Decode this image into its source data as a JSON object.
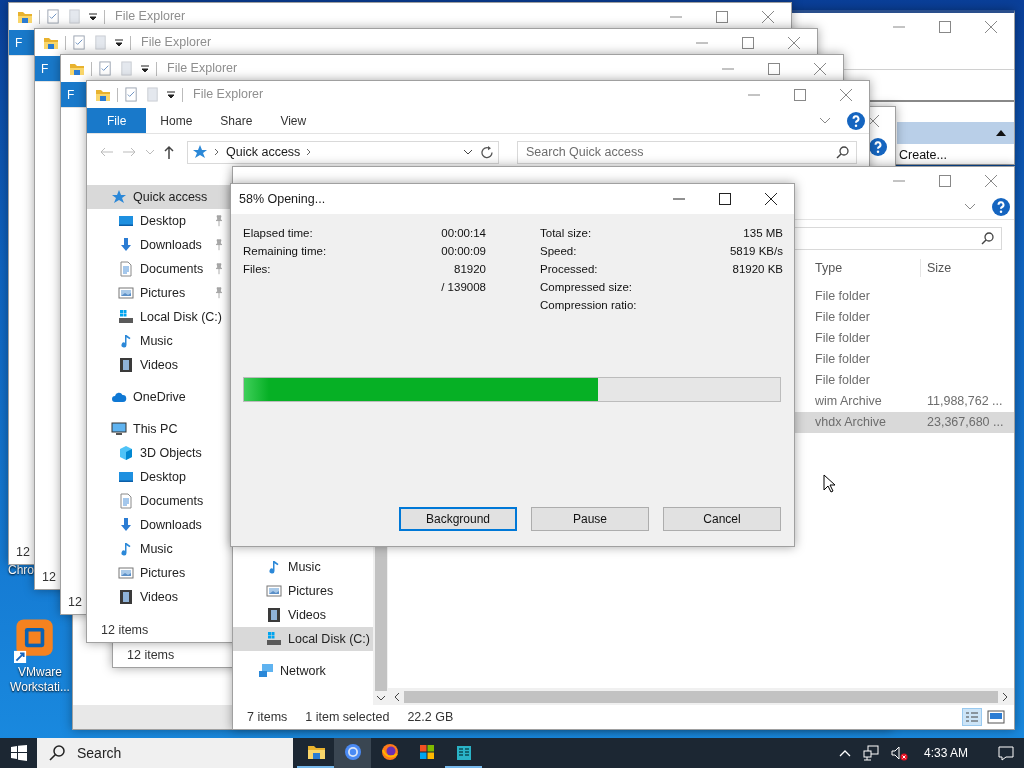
{
  "desktop_icons": [
    {
      "label": "Chro",
      "kind": "label-only"
    },
    {
      "label": "VMware Workstati...",
      "kind": "app"
    }
  ],
  "back_windows": [
    {
      "title": "File Explorer",
      "file_tab": "F",
      "status": "12"
    },
    {
      "title": "File Explorer",
      "file_tab": "F",
      "status": "12"
    },
    {
      "title": "File Explorer",
      "file_tab": "F",
      "status": "12"
    }
  ],
  "rear_window": {
    "status": "12 items"
  },
  "side_window": {
    "link": "Create..."
  },
  "explorer": {
    "title": "File Explorer",
    "ribbon_tabs": [
      {
        "label": "File",
        "selected": true
      },
      {
        "label": "Home",
        "selected": false
      },
      {
        "label": "Share",
        "selected": false
      },
      {
        "label": "View",
        "selected": false
      }
    ],
    "address": "Quick access",
    "search": {
      "placeholder": "Search Quick access"
    },
    "sidebar": [
      {
        "label": "Quick access",
        "kind": "star",
        "selected": true,
        "children": [
          {
            "label": "Desktop",
            "kind": "desktop",
            "pinned": true
          },
          {
            "label": "Downloads",
            "kind": "downloads",
            "pinned": true
          },
          {
            "label": "Documents",
            "kind": "documents",
            "pinned": true
          },
          {
            "label": "Pictures",
            "kind": "pictures",
            "pinned": true
          },
          {
            "label": "Local Disk (C:)",
            "kind": "disk",
            "pinned": false
          },
          {
            "label": "Music",
            "kind": "music",
            "pinned": false
          },
          {
            "label": "Videos",
            "kind": "videos",
            "pinned": false
          }
        ]
      },
      {
        "label": "OneDrive",
        "kind": "cloud",
        "selected": false
      },
      {
        "label": "This PC",
        "kind": "pc",
        "selected": false,
        "children": [
          {
            "label": "3D Objects",
            "kind": "cube"
          },
          {
            "label": "Desktop",
            "kind": "desktop"
          },
          {
            "label": "Documents",
            "kind": "documents"
          },
          {
            "label": "Downloads",
            "kind": "downloads"
          },
          {
            "label": "Music",
            "kind": "music"
          },
          {
            "label": "Pictures",
            "kind": "pictures"
          },
          {
            "label": "Videos",
            "kind": "videos"
          }
        ]
      }
    ],
    "status": "12 items"
  },
  "disk_window": {
    "columns": [
      "Type",
      "Size"
    ],
    "rows": [
      {
        "type": "File folder",
        "selected": false
      },
      {
        "type": "File folder",
        "selected": false
      },
      {
        "type": "File folder",
        "selected": false
      },
      {
        "type": "File folder",
        "selected": false
      },
      {
        "type": "File folder",
        "selected": false
      },
      {
        "type": "wim Archive",
        "size": "11,988,762 ...",
        "selected": false
      },
      {
        "type": "vhdx Archive",
        "size": "23,367,680 ...",
        "selected": true
      }
    ],
    "sidebar": [
      {
        "label": "Music",
        "kind": "music",
        "selected": false
      },
      {
        "label": "Pictures",
        "kind": "pictures",
        "selected": false
      },
      {
        "label": "Videos",
        "kind": "videos",
        "selected": false
      },
      {
        "label": "Local Disk (C:)",
        "kind": "disk",
        "selected": true
      }
    ],
    "roots": [
      {
        "label": "Network",
        "kind": "network"
      }
    ],
    "status": {
      "count": "7 items",
      "selection": "1 item selected",
      "size": "22.2 GB"
    }
  },
  "dialog": {
    "title": "58% Opening...",
    "left_stats": [
      {
        "label": "Elapsed time:",
        "value": "00:00:14"
      },
      {
        "label": "Remaining time:",
        "value": "00:00:09"
      },
      {
        "label": "Files:",
        "value": "81920"
      },
      {
        "value": "/ 139008"
      }
    ],
    "right_stats": [
      {
        "label": "Total size:",
        "value": "135 MB"
      },
      {
        "label": "Speed:",
        "value": "5819 KB/s"
      },
      {
        "label": "Processed:",
        "value": "81920 KB"
      },
      {
        "label": "Compressed size:"
      },
      {
        "label": "Compression ratio:"
      }
    ],
    "progress": {
      "level": 0.66
    },
    "buttons": [
      {
        "label": "Background",
        "default": true
      },
      {
        "label": "Pause",
        "default": false
      },
      {
        "label": "Cancel",
        "default": false
      }
    ]
  },
  "taskbar": {
    "search_placeholder": "Search",
    "apps": [
      {
        "kind": "explorer",
        "running": true,
        "highlighted": false
      },
      {
        "kind": "chrome",
        "running": false,
        "highlighted": true
      },
      {
        "kind": "firefox",
        "running": false,
        "highlighted": false
      },
      {
        "kind": "store",
        "running": false,
        "highlighted": false
      },
      {
        "kind": "calculator",
        "running": true,
        "highlighted": false
      }
    ],
    "clock": "4:33 AM"
  }
}
